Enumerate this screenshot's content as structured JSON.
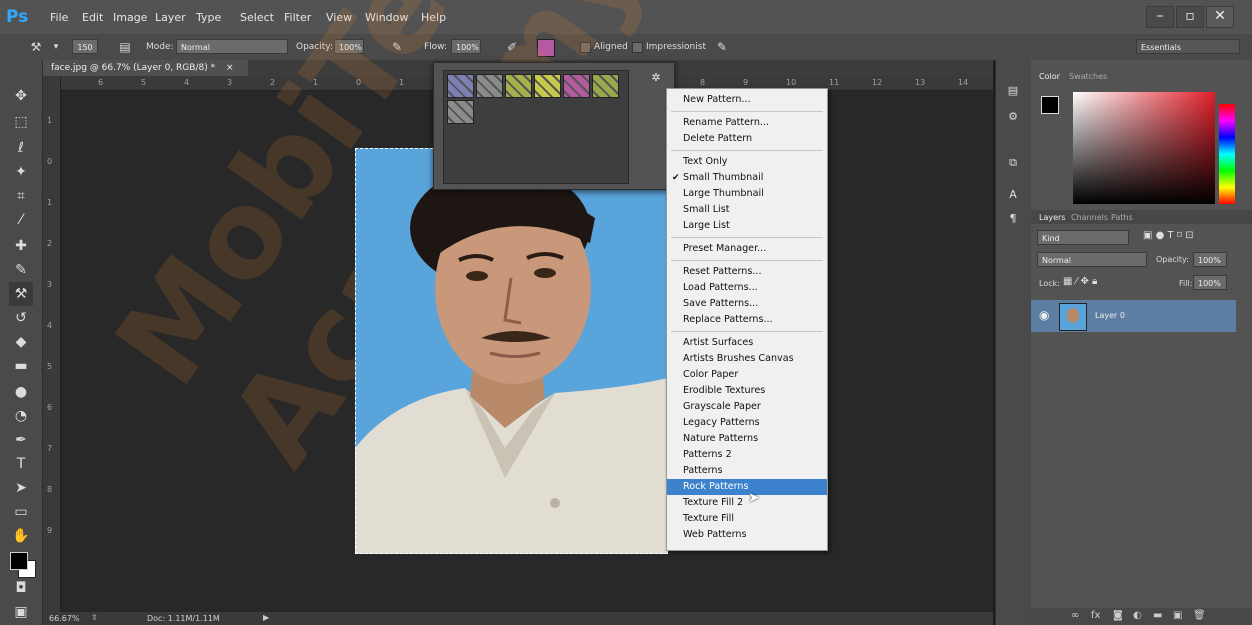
{
  "app": {
    "logo": "Ps"
  },
  "menubar": {
    "items": [
      "File",
      "Edit",
      "Image",
      "Layer",
      "Type",
      "Select",
      "Filter",
      "View",
      "Window",
      "Help"
    ],
    "window_controls": [
      "–",
      "▫",
      "✕"
    ]
  },
  "options_bar": {
    "brush_size": "150",
    "mode_label": "Mode:",
    "mode_value": "Normal",
    "opacity_label": "Opacity:",
    "opacity_value": "100%",
    "flow_label": "Flow:",
    "flow_value": "100%",
    "aligned_label": "Aligned",
    "impressionist_label": "Impressionist",
    "workspace": "Essentials"
  },
  "document": {
    "tab_title": "face.jpg @ 66.7% (Layer 0, RGB/8) *",
    "tab_close": "×",
    "ruler_top": [
      "6",
      "5",
      "4",
      "3",
      "2",
      "1",
      "0",
      "1",
      "2",
      "3",
      "4",
      "5",
      "6",
      "7",
      "8",
      "9",
      "10",
      "11",
      "12",
      "13",
      "14"
    ],
    "ruler_left": [
      "1",
      "0",
      "1",
      "2",
      "3",
      "4",
      "5",
      "6",
      "7",
      "8",
      "9"
    ],
    "status_zoom": "66.67%",
    "status_doc": "Doc: 1.11M/1.11M"
  },
  "pattern_picker": {
    "gear": "✲",
    "swatch_colors": [
      "#7f7fb8",
      "#8a8a8a",
      "#a8b04a",
      "#c8c84a",
      "#b45aa0",
      "#9aa84a",
      "#8c8c8c"
    ]
  },
  "pattern_menu": {
    "groups": [
      [
        "New Pattern..."
      ],
      [
        "Rename Pattern...",
        "Delete Pattern"
      ],
      [
        "Text Only",
        "Small Thumbnail",
        "Large Thumbnail",
        "Small List",
        "Large List"
      ],
      [
        "Preset Manager..."
      ],
      [
        "Reset Patterns...",
        "Load Patterns...",
        "Save Patterns...",
        "Replace Patterns..."
      ],
      [
        "Artist Surfaces",
        "Artists Brushes Canvas",
        "Color Paper",
        "Erodible Textures",
        "Grayscale Paper",
        "Legacy Patterns",
        "Nature Patterns",
        "Patterns 2",
        "Patterns",
        "Rock Patterns",
        "Texture Fill 2",
        "Texture Fill",
        "Web Patterns"
      ]
    ],
    "checked_item": "Small Thumbnail",
    "highlighted_item": "Rock Patterns",
    "checkmark": "✔"
  },
  "right_panel": {
    "color_tabs": [
      "Color",
      "Swatches"
    ],
    "layer_tabs": [
      "Layers",
      "Channels",
      "Paths"
    ],
    "kind_label": "Kind",
    "blend_mode": "Normal",
    "opacity_label": "Opacity:",
    "opacity_value": "100%",
    "lock_label": "Lock:",
    "fill_label": "Fill:",
    "fill_value": "100%",
    "layer_name": "Layer 0"
  },
  "watermark": {
    "text": "MobiTech Academy"
  },
  "colors": {
    "accent": "#3d82cc",
    "ps_blue": "#31a8ff",
    "photo_bg": "#5aa4dc"
  }
}
